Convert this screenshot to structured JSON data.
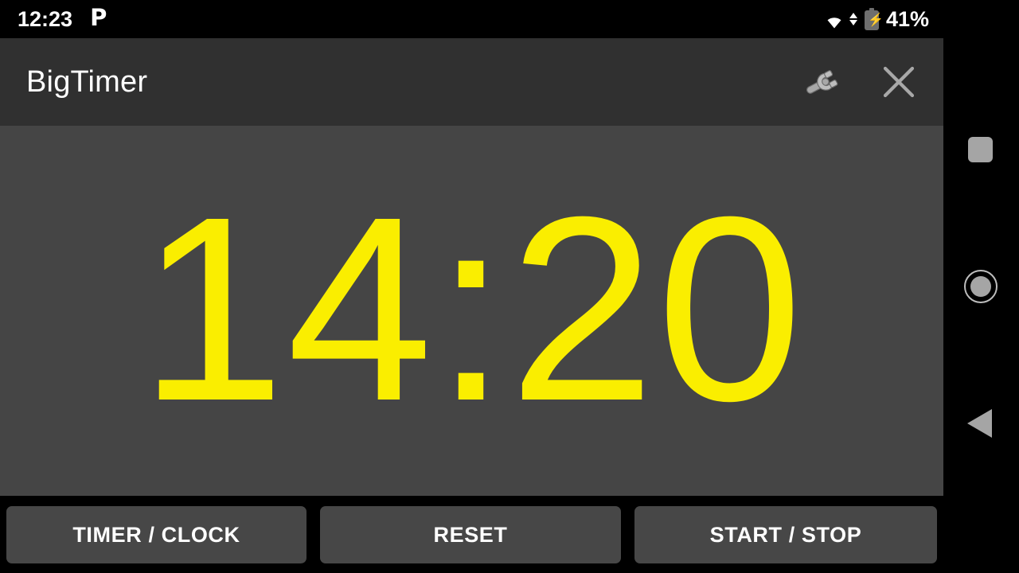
{
  "status_bar": {
    "clock": "12:23",
    "notification_icon": "P",
    "wifi_icon": "wifi-icon",
    "data_arrows_icon": "data-transfer-arrows-icon",
    "battery_icon": "battery-charging-icon",
    "battery_percent": "41%"
  },
  "app_header": {
    "title": "BigTimer",
    "settings_icon": "wrench-icon",
    "close_icon": "close-icon"
  },
  "timer": {
    "value": "14:20",
    "color": "#faee00",
    "background": "#454545"
  },
  "buttons": [
    {
      "id": "timer-clock",
      "label": "TIMER / CLOCK"
    },
    {
      "id": "reset",
      "label": "RESET"
    },
    {
      "id": "start-stop",
      "label": "START / STOP"
    }
  ],
  "nav_bar": {
    "recents_icon": "square-recents-icon",
    "home_icon": "circle-home-icon",
    "back_icon": "triangle-back-icon"
  },
  "colors": {
    "header_bg": "#303030",
    "content_bg": "#454545",
    "button_bg": "#474747",
    "accent_yellow": "#faee00",
    "icon_gray": "#a5a5a5",
    "screen_bg": "#000000"
  }
}
